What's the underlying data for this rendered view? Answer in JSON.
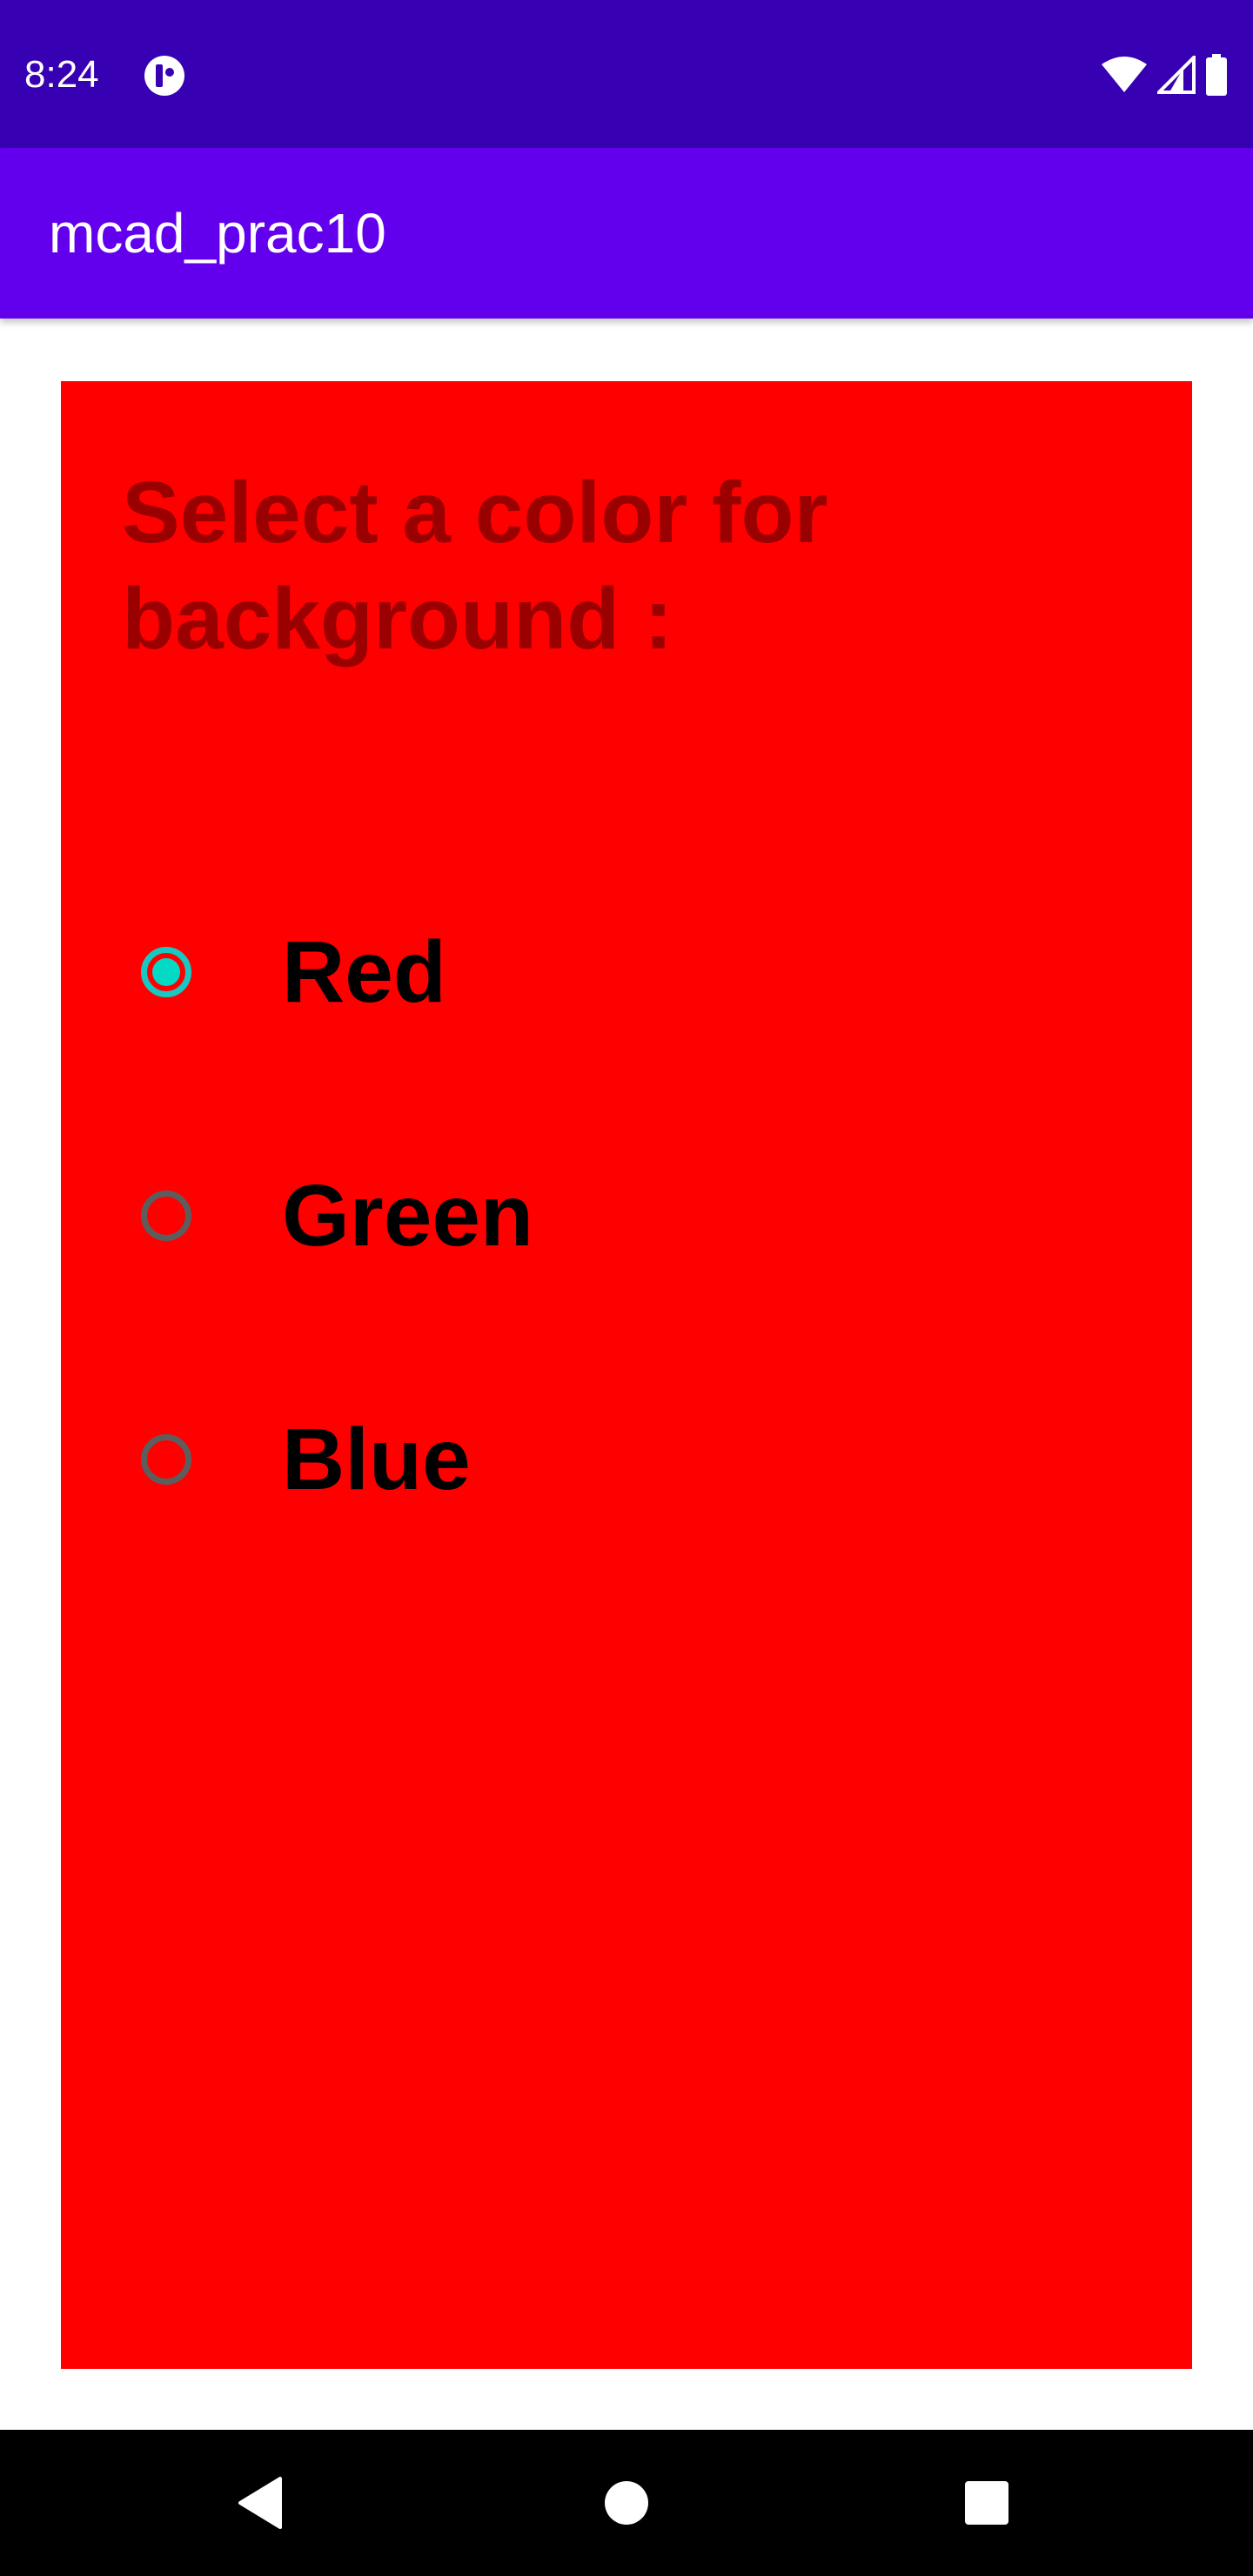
{
  "status_bar": {
    "time": "8:24",
    "app_icon": "tracking-app-icon",
    "wifi_icon": "wifi-icon",
    "signal_icon": "cell-signal-icon",
    "battery_icon": "battery-icon"
  },
  "app_bar": {
    "title": "mcad_prac10"
  },
  "main": {
    "background_color": "#ff0000",
    "prompt": "Select a color for background :",
    "radio_options": [
      {
        "label": "Red",
        "checked": true
      },
      {
        "label": "Green",
        "checked": false
      },
      {
        "label": "Blue",
        "checked": false
      }
    ]
  },
  "nav_bar": {
    "back_icon": "back-triangle-icon",
    "home_icon": "home-circle-icon",
    "recents_icon": "recents-square-icon"
  },
  "colors": {
    "status_bar": "#3700b3",
    "app_bar": "#6200ee",
    "accent": "#03dac5"
  }
}
